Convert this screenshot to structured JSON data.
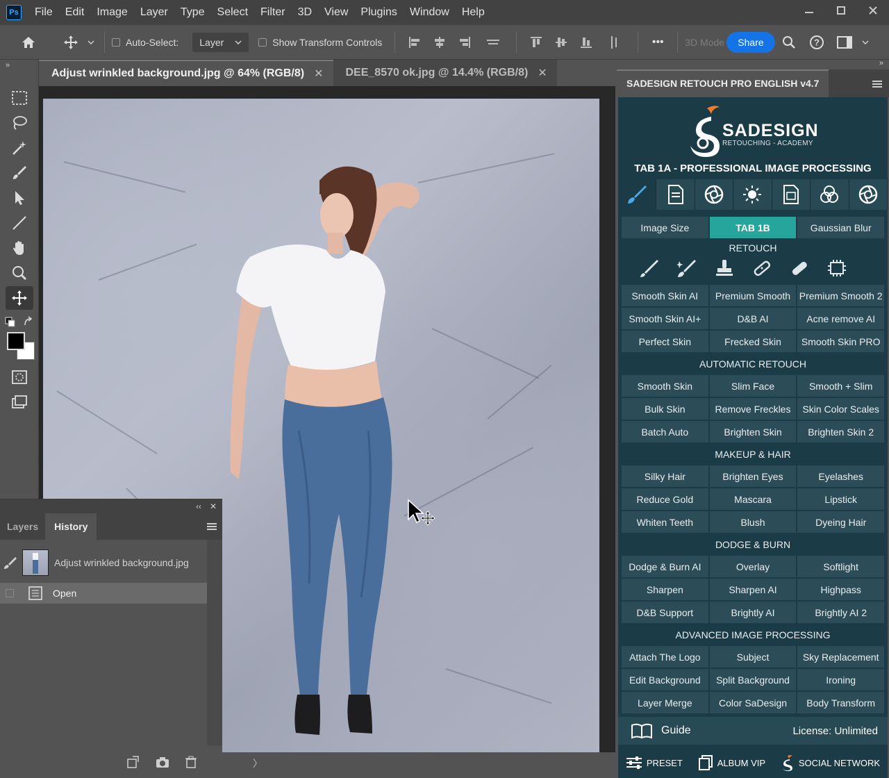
{
  "menubar": {
    "logo": "Ps",
    "items": [
      "File",
      "Edit",
      "Image",
      "Layer",
      "Type",
      "Select",
      "Filter",
      "3D",
      "View",
      "Plugins",
      "Window",
      "Help"
    ]
  },
  "options_bar": {
    "auto_select_label": "Auto-Select:",
    "auto_select_value": "Layer",
    "show_transform_label": "Show Transform Controls",
    "three_d_mode": "3D Mode",
    "share_label": "Share",
    "more_label": "•••"
  },
  "doc_tabs": [
    {
      "label": "Adjust wrinkled background.jpg @ 64% (RGB/8)",
      "active": true
    },
    {
      "label": "DEE_8570 ok.jpg @ 14.4% (RGB/8)",
      "active": false
    }
  ],
  "layers_panel": {
    "tabs": [
      "Layers",
      "History"
    ],
    "active_tab": "History",
    "history": [
      {
        "label": "Adjust wrinkled background.jpg"
      },
      {
        "label": "Open"
      }
    ]
  },
  "plugin_panel": {
    "title": "SADESIGN RETOUCH PRO ENGLISH v4.7",
    "brand_name": "SADESIGN",
    "brand_sub": "RETOUCHING - ACADEMY",
    "tab_heading": "TAB 1A - PROFESSIONAL IMAGE PROCESSING",
    "top_buttons": [
      "Image Size",
      "TAB 1B",
      "Gaussian Blur"
    ],
    "sections": [
      {
        "heading": "RETOUCH",
        "rows": [
          [
            "Smooth Skin AI",
            "Premium Smooth",
            "Premium Smooth 2"
          ],
          [
            "Smooth Skin AI+",
            "D&B AI",
            "Acne remove AI"
          ],
          [
            "Perfect Skin",
            "Frecked Skin",
            "Smooth Skin PRO"
          ]
        ]
      },
      {
        "heading": "AUTOMATIC RETOUCH",
        "rows": [
          [
            "Smooth Skin",
            "Slim Face",
            "Smooth + Slim"
          ],
          [
            "Bulk Skin",
            "Remove Freckles",
            "Skin Color Scales"
          ],
          [
            "Batch Auto",
            "Brighten Skin",
            "Brighten Skin 2"
          ]
        ]
      },
      {
        "heading": "MAKEUP & HAIR",
        "rows": [
          [
            "Silky Hair",
            "Brighten Eyes",
            "Eyelashes"
          ],
          [
            "Reduce Gold",
            "Mascara",
            "Lipstick"
          ],
          [
            "Whiten Teeth",
            "Blush",
            "Dyeing Hair"
          ]
        ]
      },
      {
        "heading": "DODGE & BURN",
        "rows": [
          [
            "Dodge & Burn AI",
            "Overlay",
            "Softlight"
          ],
          [
            "Sharpen",
            "Sharpen AI",
            "Highpass"
          ],
          [
            "D&B Support",
            "Brightly AI",
            "Brightly AI 2"
          ]
        ]
      },
      {
        "heading": "ADVANCED IMAGE PROCESSING",
        "rows": [
          [
            "Attach The Logo",
            "Subject",
            "Sky Replacement"
          ],
          [
            "Edit Background",
            "Split Background",
            "Ironing"
          ],
          [
            "Layer Merge",
            "Color SaDesign",
            "Body Transform"
          ]
        ]
      }
    ],
    "guide_label": "Guide",
    "license_label": "License: Unlimited",
    "footer": [
      "PRESET",
      "ALBUM VIP",
      "SOCIAL NETWORK"
    ]
  },
  "colors": {
    "panel_bg": "#1b3c47",
    "button_bg": "#2c4d58",
    "active_button": "#26a59c",
    "share_blue": "#1473e6",
    "brand_orange": "#f07a2a"
  }
}
